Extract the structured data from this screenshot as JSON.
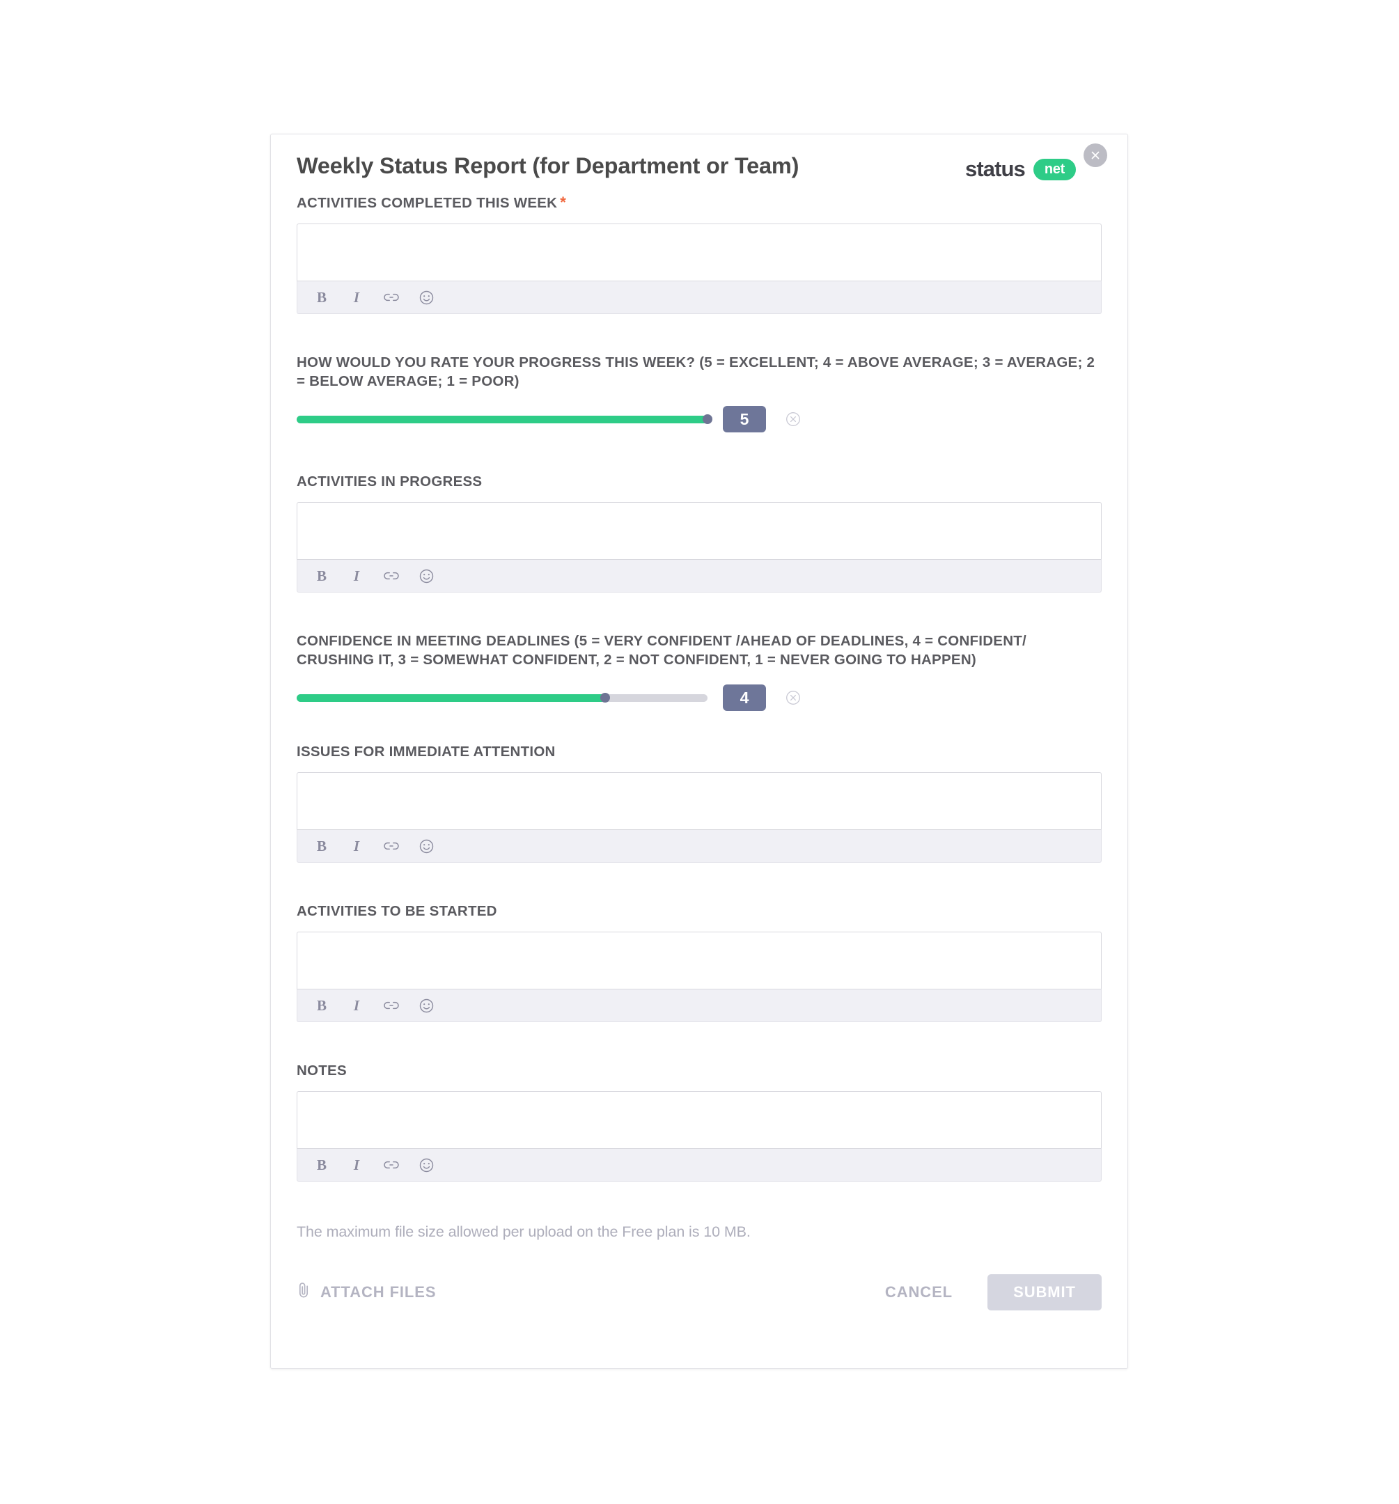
{
  "brand": {
    "word": "status",
    "pill": "net"
  },
  "header": {
    "title": "Weekly Status Report (for Department or Team)",
    "close_icon": "close-icon"
  },
  "colors": {
    "accent_green": "#2ecc87",
    "badge_slate": "#6e7699",
    "required_star": "#f0663c",
    "label_gray": "#5a5a5f",
    "muted_gray": "#aeaebb",
    "submit_disabled": "#d5d6e0"
  },
  "editor_toolbar": {
    "items": [
      {
        "name": "bold-icon",
        "glyph": "B"
      },
      {
        "name": "italic-icon",
        "glyph": "I"
      },
      {
        "name": "link-icon",
        "glyph": "link"
      },
      {
        "name": "emoji-icon",
        "glyph": "smiley"
      }
    ]
  },
  "fields": [
    {
      "id": "activities-completed",
      "label": "ACTIVITIES COMPLETED THIS WEEK",
      "required": true,
      "required_marker": "*",
      "type": "richtext",
      "value": "",
      "placeholder": ""
    },
    {
      "id": "progress-rating",
      "label": "HOW WOULD YOU RATE YOUR PROGRESS THIS WEEK? (5 = EXCELLENT; 4 = ABOVE AVERAGE; 3 = AVERAGE; 2 = BELOW AVERAGE; 1 = POOR)",
      "required": false,
      "type": "slider",
      "value": "5",
      "min": 1,
      "max": 5,
      "fill_percent": 100,
      "clear_icon": "clear-circle-icon"
    },
    {
      "id": "activities-in-progress",
      "label": "ACTIVITIES IN PROGRESS",
      "required": false,
      "type": "richtext",
      "value": "",
      "placeholder": ""
    },
    {
      "id": "confidence-deadlines",
      "label": "CONFIDENCE IN MEETING DEADLINES (5 = VERY CONFIDENT /AHEAD OF DEADLINES, 4 = CONFIDENT/ CRUSHING IT, 3 = SOMEWHAT CONFIDENT, 2 = NOT CONFIDENT, 1 = NEVER GOING TO HAPPEN)",
      "required": false,
      "type": "slider",
      "value": "4",
      "min": 1,
      "max": 5,
      "fill_percent": 75,
      "clear_icon": "clear-circle-icon"
    },
    {
      "id": "issues-immediate-attention",
      "label": "ISSUES FOR IMMEDIATE ATTENTION",
      "required": false,
      "type": "richtext",
      "value": "",
      "placeholder": ""
    },
    {
      "id": "activities-to-be-started",
      "label": "ACTIVITIES TO BE STARTED",
      "required": false,
      "type": "richtext",
      "value": "",
      "placeholder": ""
    },
    {
      "id": "notes",
      "label": "NOTES",
      "required": false,
      "type": "richtext",
      "value": "",
      "placeholder": ""
    }
  ],
  "footer": {
    "note": "The maximum file size allowed per upload on the Free plan is 10 MB.",
    "attach_label": "ATTACH FILES",
    "attach_icon": "paperclip-icon",
    "cancel_label": "CANCEL",
    "submit_label": "SUBMIT",
    "submit_disabled": true
  }
}
